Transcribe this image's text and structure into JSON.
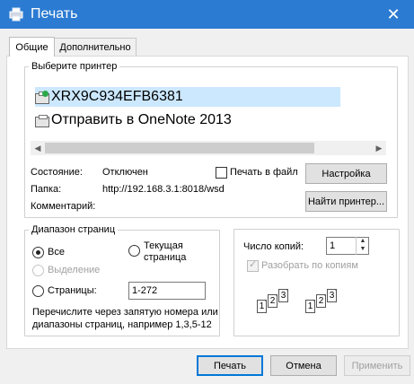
{
  "window": {
    "title": "Печать",
    "close_glyph": "✕"
  },
  "tabs": [
    {
      "label": "Общие",
      "active": true
    },
    {
      "label": "Дополнительно",
      "active": false
    }
  ],
  "printer_group": {
    "legend": "Выберите принтер",
    "printers": [
      {
        "name": "XRX9C934EFB6381",
        "icon": "network-printer-ok-icon",
        "selected": true
      },
      {
        "name": "Отправить в OneNote 2013",
        "icon": "printer-icon",
        "selected": false
      }
    ],
    "status_label": "Состояние:",
    "status_value": "Отключен",
    "location_label": "Папка:",
    "location_value": "http://192.168.3.1:8018/wsd",
    "comment_label": "Комментарий:",
    "print_to_file_label": "Печать в файл",
    "preferences_button": "Настройка",
    "find_printer_button": "Найти принтер..."
  },
  "page_range": {
    "legend": "Диапазон страниц",
    "all_label": "Все",
    "current_page_label_1": "Текущая",
    "current_page_label_2": "страница",
    "selection_label": "Выделение",
    "pages_label": "Страницы:",
    "pages_value": "1-272",
    "hint_line_1": "Перечислите через запятую номера или",
    "hint_line_2": "диапазоны страниц, например 1,3,5-12"
  },
  "copies": {
    "label": "Число копий:",
    "value": "1",
    "collate_label": "Разобрать по копиям",
    "page_numbers": [
      "1",
      "2",
      "3"
    ]
  },
  "footer": {
    "print_button": "Печать",
    "cancel_button": "Отмена",
    "apply_button": "Применить"
  },
  "colors": {
    "titlebar": "#2b7bd2",
    "selection": "#cce8ff",
    "default_button_border": "#0078d7"
  }
}
